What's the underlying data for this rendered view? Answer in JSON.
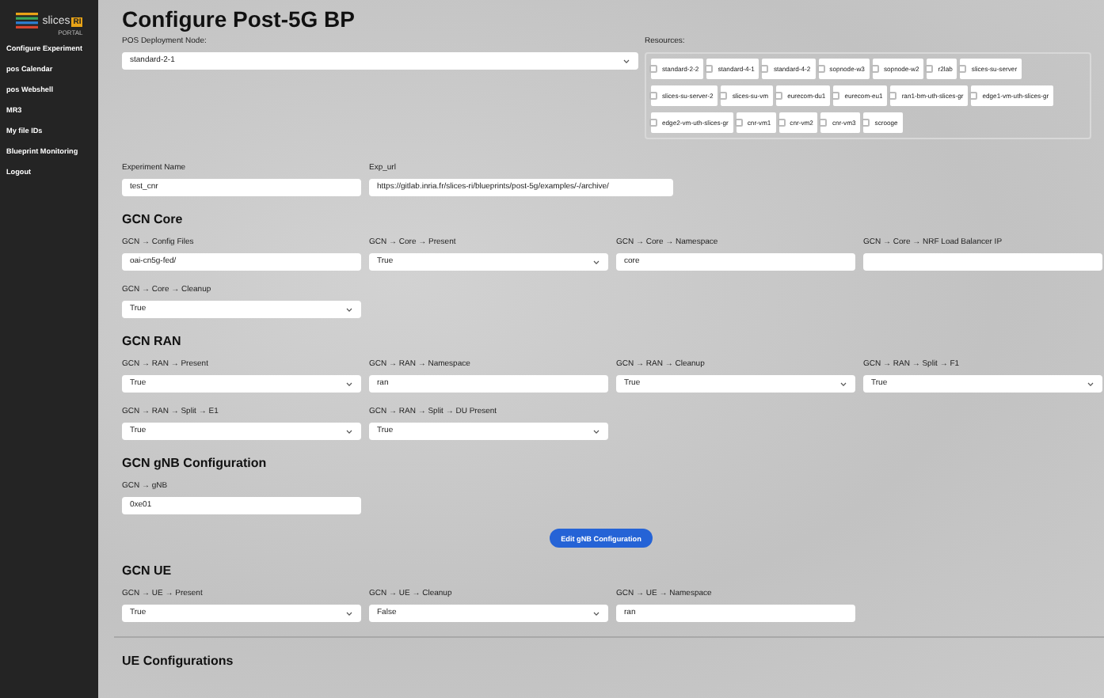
{
  "sidebar": {
    "logo": {
      "name": "slices",
      "badge": "RI",
      "sub": "PORTAL"
    },
    "items": [
      {
        "label": "Configure Experiment"
      },
      {
        "label": "pos Calendar"
      },
      {
        "label": "pos Webshell"
      },
      {
        "label": "MR3"
      },
      {
        "label": "My file IDs"
      },
      {
        "label": "Blueprint Monitoring"
      },
      {
        "label": "Logout"
      }
    ]
  },
  "title": "Configure Post-5G BP",
  "deployment": {
    "label": "POS Deployment Node:",
    "kind": "select",
    "value": "standard-2-1"
  },
  "resources": {
    "label": "Resources:",
    "items": [
      {
        "label": "standard-2-2",
        "checked": false
      },
      {
        "label": "standard-4-1",
        "checked": false
      },
      {
        "label": "standard-4-2",
        "checked": false
      },
      {
        "label": "sopnode-w3",
        "checked": false
      },
      {
        "label": "sopnode-w2",
        "checked": false
      },
      {
        "label": "r2lab",
        "checked": false
      },
      {
        "label": "slices-su-server",
        "checked": false
      },
      {
        "label": "slices-su-server-2",
        "checked": false
      },
      {
        "label": "slices-su-vm",
        "checked": false
      },
      {
        "label": "eurecom-du1",
        "checked": false
      },
      {
        "label": "eurecom-eu1",
        "checked": false
      },
      {
        "label": "ran1-bm-uth-slices-gr",
        "checked": false
      },
      {
        "label": "edge1-vm-uth-slices-gr",
        "checked": false
      },
      {
        "label": "edge2-vm-uth-slices-gr",
        "checked": false
      },
      {
        "label": "cnr-vm1",
        "checked": false
      },
      {
        "label": "cnr-vm2",
        "checked": false
      },
      {
        "label": "cnr-vm3",
        "checked": false
      },
      {
        "label": "scrooge",
        "checked": false
      }
    ]
  },
  "experiment": [
    {
      "label": "Experiment Name",
      "kind": "text",
      "value": "test_cnr"
    },
    {
      "label": "Exp_url",
      "kind": "text",
      "value": "https://gitlab.inria.fr/slices-ri/blueprints/post-5g/examples/-/archive/"
    }
  ],
  "sections": [
    {
      "title": "GCN Core",
      "rows": [
        [
          {
            "label": "GCN → Config Files",
            "kind": "text",
            "value": "oai-cn5g-fed/"
          },
          {
            "label": "GCN → Core → Present",
            "kind": "select",
            "value": "True"
          },
          {
            "label": "GCN → Core → Namespace",
            "kind": "text",
            "value": "core"
          },
          {
            "label": "GCN → Core → NRF Load Balancer IP",
            "kind": "text"
          }
        ],
        [
          {
            "label": "GCN → Core → Cleanup",
            "kind": "select",
            "value": "True"
          }
        ]
      ]
    },
    {
      "title": "GCN RAN",
      "rows": [
        [
          {
            "label": "GCN → RAN → Present",
            "kind": "select",
            "value": "True"
          },
          {
            "label": "GCN → RAN → Namespace",
            "kind": "text",
            "value": "ran"
          },
          {
            "label": "GCN → RAN → Cleanup",
            "kind": "select",
            "value": "True"
          },
          {
            "label": "GCN → RAN → Split → F1",
            "kind": "select",
            "value": "True"
          }
        ],
        [
          {
            "label": "GCN → RAN → Split → E1",
            "kind": "select",
            "value": "True"
          },
          {
            "label": "GCN → RAN → Split → DU Present",
            "kind": "select",
            "value": "True"
          }
        ]
      ]
    },
    {
      "title": "GCN gNB Configuration",
      "rows": [
        [
          {
            "label": "GCN → gNB",
            "kind": "text",
            "value": "0xe01"
          }
        ]
      ],
      "action": "Edit gNB Configuration"
    },
    {
      "title": "GCN UE",
      "rows": [
        [
          {
            "label": "GCN → UE → Present",
            "kind": "select",
            "value": "True"
          },
          {
            "label": "GCN → UE → Cleanup",
            "kind": "select",
            "value": "False"
          },
          {
            "label": "GCN → UE → Namespace",
            "kind": "text",
            "value": "ran"
          }
        ]
      ]
    }
  ],
  "ue_configurations": {
    "title": "UE Configurations"
  }
}
